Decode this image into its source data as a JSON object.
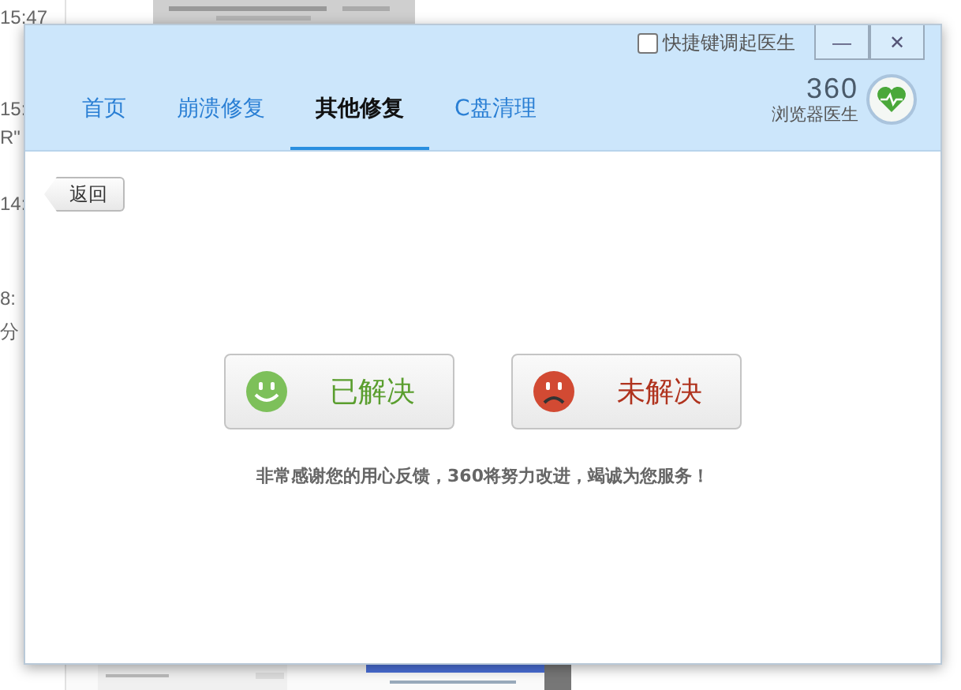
{
  "background": {
    "times": [
      "15:47",
      "15:",
      "R\"",
      "14:",
      "8:",
      "分"
    ]
  },
  "window": {
    "shortcut_checkbox": {
      "label": "快捷键调起医生",
      "checked": false
    },
    "controls": [
      "—",
      "✕"
    ],
    "tabs": [
      {
        "label": "首页",
        "selected": false
      },
      {
        "label": "崩溃修复",
        "selected": false
      },
      {
        "label": "其他修复",
        "selected": true
      },
      {
        "label": "C盘清理",
        "selected": false
      }
    ],
    "logo": {
      "number": "360",
      "name": "浏览器医生"
    },
    "back_button": "返回",
    "feedback_buttons": [
      {
        "kind": "solved",
        "label": "已解决"
      },
      {
        "kind": "unsolved",
        "label": "未解决"
      }
    ],
    "message": "非常感谢您的用心反馈，360将努力改进，竭诚为您服务！"
  }
}
